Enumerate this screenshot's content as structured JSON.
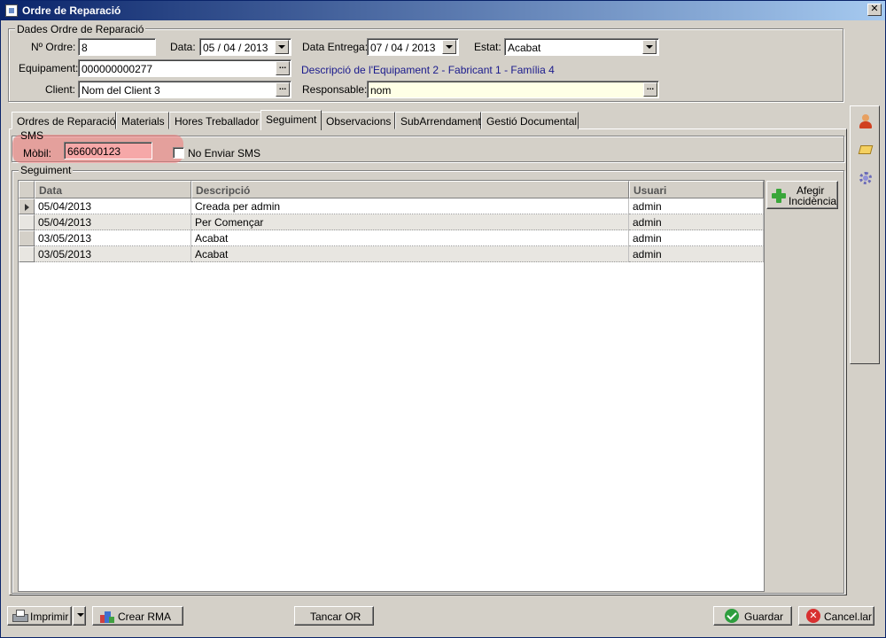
{
  "window": {
    "title": "Ordre de Reparació",
    "close_glyph": "✕"
  },
  "header_group": {
    "legend": "Dades Ordre de Reparació",
    "order_no_label": "Nº Ordre:",
    "order_no_value": "8",
    "date_label": "Data:",
    "date_value": "05 / 04 / 2013",
    "delivery_label": "Data Entrega:",
    "delivery_value": "07 / 04 / 2013",
    "state_label": "Estat:",
    "state_value": "Acabat",
    "equipment_label": "Equipament:",
    "equipment_value": "000000000277",
    "equipment_description": "Descripció de l'Equipament 2 - Fabricant 1 - Família 4",
    "client_label": "Client:",
    "client_value": "Nom del Client 3",
    "responsible_label": "Responsable:",
    "responsible_value": "nom",
    "dots": "..."
  },
  "tabs": [
    {
      "label": "Ordres de Reparació"
    },
    {
      "label": "Materials"
    },
    {
      "label": "Hores Treballador"
    },
    {
      "label": "Seguiment"
    },
    {
      "label": "Observacions"
    },
    {
      "label": "SubArrendament"
    },
    {
      "label": "Gestió Documental"
    }
  ],
  "active_tab": "Seguiment",
  "sms": {
    "legend": "SMS",
    "mobile_label": "Mòbil:",
    "mobile_value": "666000123",
    "no_sms_label": "No Enviar SMS",
    "no_sms_checked": false,
    "highlight_color": "#f07878"
  },
  "tracking": {
    "legend": "Seguiment",
    "columns": [
      "Data",
      "Descripció",
      "Usuari"
    ],
    "rows": [
      {
        "date": "05/04/2013",
        "description": "Creada per admin",
        "user": "admin",
        "current": true
      },
      {
        "date": "05/04/2013",
        "description": "Per Començar",
        "user": "admin",
        "current": false
      },
      {
        "date": "03/05/2013",
        "description": "Acabat",
        "user": "admin",
        "current": false
      },
      {
        "date": "03/05/2013",
        "description": "Acabat",
        "user": "admin",
        "current": false
      }
    ],
    "add_incident_line1": "Afegir",
    "add_incident_line2": "Incidència"
  },
  "side_toolbar": {
    "icons": [
      "person-icon",
      "note-icon",
      "gear-icon"
    ]
  },
  "footer": {
    "print_label": "Imprimir",
    "create_rma_label": "Crear RMA",
    "close_or_label": "Tancar OR",
    "save_label": "Guardar",
    "cancel_label": "Cancel.lar"
  },
  "colors": {
    "title_start": "#0a246a",
    "title_end": "#a6caf0",
    "face": "#d4d0c8",
    "link": "#1a1a8c",
    "responsible_bg": "#ffffe6",
    "highlight": "#f07878"
  }
}
